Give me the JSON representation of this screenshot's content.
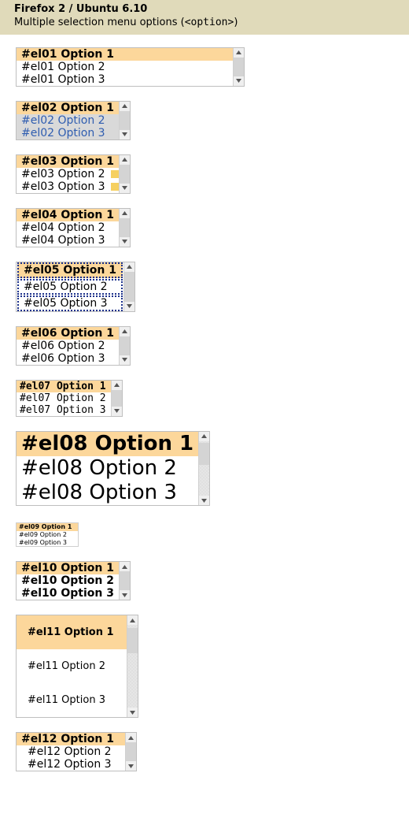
{
  "header": {
    "title": "Firefox 2 / Ubuntu 6.10",
    "subtitle_prefix": "Multiple selection menu options (",
    "subtitle_code": "<option>",
    "subtitle_suffix": ")"
  },
  "selects": {
    "el01": {
      "o1": "#el01 Option 1",
      "o2": "#el01 Option 2",
      "o3": "#el01 Option 3"
    },
    "el02": {
      "o1": "#el02 Option 1",
      "o2": "#el02 Option 2",
      "o3": "#el02 Option 3"
    },
    "el03": {
      "o1": "#el03 Option 1",
      "o2": "#el03 Option 2",
      "o3": "#el03 Option 3"
    },
    "el04": {
      "o1": "#el04 Option 1",
      "o2": "#el04 Option 2",
      "o3": "#el04 Option 3"
    },
    "el05": {
      "o1": "#el05 Option 1",
      "o2": "#el05 Option 2",
      "o3": "#el05 Option 3"
    },
    "el06": {
      "o1": "#el06 Option 1",
      "o2": "#el06 Option 2",
      "o3": "#el06 Option 3"
    },
    "el07": {
      "o1": "#el07 Option 1",
      "o2": "#el07 Option 2",
      "o3": "#el07 Option 3"
    },
    "el08": {
      "o1": "#el08 Option 1",
      "o2": "#el08 Option 2",
      "o3": "#el08 Option 3"
    },
    "el09": {
      "o1": "#el09 Option 1",
      "o2": "#el09 Option 2",
      "o3": "#el09 Option 3"
    },
    "el10": {
      "o1": "#el10 Option 1",
      "o2": "#el10 Option 2",
      "o3": "#el10 Option 3"
    },
    "el11": {
      "o1": "#el11 Option 1",
      "o2": "#el11 Option 2",
      "o3": "#el11 Option 3"
    },
    "el12": {
      "o1": "#el12 Option 1",
      "o2": "#el12 Option 2",
      "o3": "#el12 Option 3"
    }
  },
  "colors": {
    "selected_bg": "#fcd79b",
    "highlight_bg": "#d9d9d9",
    "highlight_fg": "#2f5db0",
    "header_bg": "#e0daba",
    "dotted_border": "#1a2f8a"
  }
}
